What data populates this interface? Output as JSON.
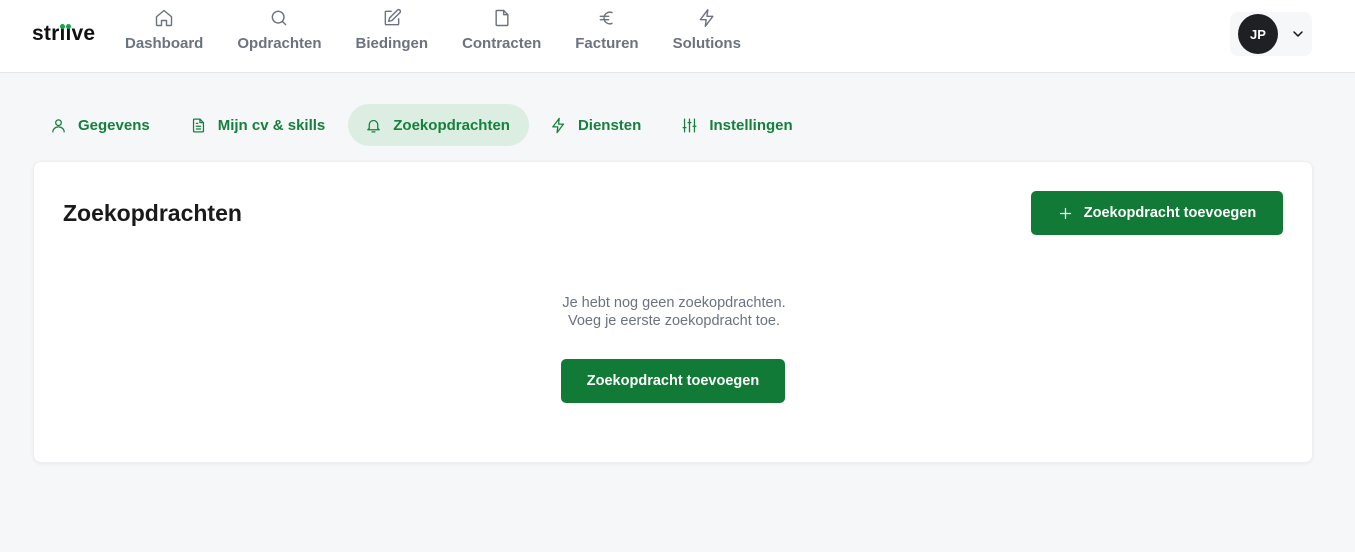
{
  "brand": {
    "name": "striive",
    "accent": "#117a37",
    "dot_color": "#16a34a"
  },
  "nav": {
    "items": [
      {
        "label": "Dashboard",
        "icon": "home-icon"
      },
      {
        "label": "Opdrachten",
        "icon": "search-icon"
      },
      {
        "label": "Biedingen",
        "icon": "edit-icon"
      },
      {
        "label": "Contracten",
        "icon": "document-icon"
      },
      {
        "label": "Facturen",
        "icon": "euro-icon"
      },
      {
        "label": "Solutions",
        "icon": "lightning-icon"
      }
    ]
  },
  "user": {
    "initials": "JP",
    "menu_icon": "chevron-down-icon"
  },
  "tabs": [
    {
      "label": "Gegevens",
      "icon": "user-icon",
      "active": false
    },
    {
      "label": "Mijn cv & skills",
      "icon": "file-text-icon",
      "active": false
    },
    {
      "label": "Zoekopdrachten",
      "icon": "bell-icon",
      "active": true
    },
    {
      "label": "Diensten",
      "icon": "lightning-icon",
      "active": false
    },
    {
      "label": "Instellingen",
      "icon": "sliders-icon",
      "active": false
    }
  ],
  "main": {
    "title": "Zoekopdrachten",
    "add_button_label": "Zoekopdracht toevoegen",
    "empty_line1": "Je hebt nog geen zoekopdrachten.",
    "empty_line2": "Voeg je eerste zoekopdracht toe.",
    "empty_button_label": "Zoekopdracht toevoegen"
  }
}
